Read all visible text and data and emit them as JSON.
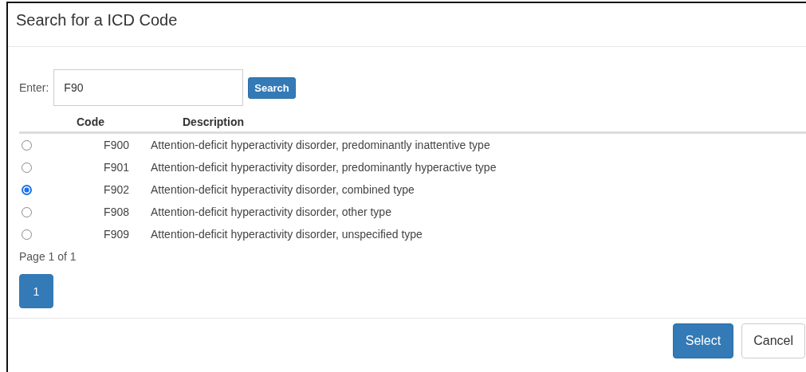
{
  "dialog": {
    "title": "Search for a ICD Code"
  },
  "search": {
    "label": "Enter:",
    "value": "F90",
    "button": "Search"
  },
  "table": {
    "columns": [
      "Code",
      "Description"
    ],
    "rows": [
      {
        "code": "F900",
        "description": "Attention-deficit hyperactivity disorder, predominantly inattentive type",
        "selected": false
      },
      {
        "code": "F901",
        "description": "Attention-deficit hyperactivity disorder, predominantly hyperactive type",
        "selected": false
      },
      {
        "code": "F902",
        "description": "Attention-deficit hyperactivity disorder, combined type",
        "selected": true
      },
      {
        "code": "F908",
        "description": "Attention-deficit hyperactivity disorder, other type",
        "selected": false
      },
      {
        "code": "F909",
        "description": "Attention-deficit hyperactivity disorder, unspecified type",
        "selected": false
      }
    ]
  },
  "pager": {
    "status": "Page 1 of 1",
    "pages": [
      {
        "label": "1",
        "selected": true
      }
    ]
  },
  "buttons": [
    {
      "label": "Select",
      "kind": "primary"
    },
    {
      "label": "Cancel",
      "kind": "default"
    }
  ]
}
